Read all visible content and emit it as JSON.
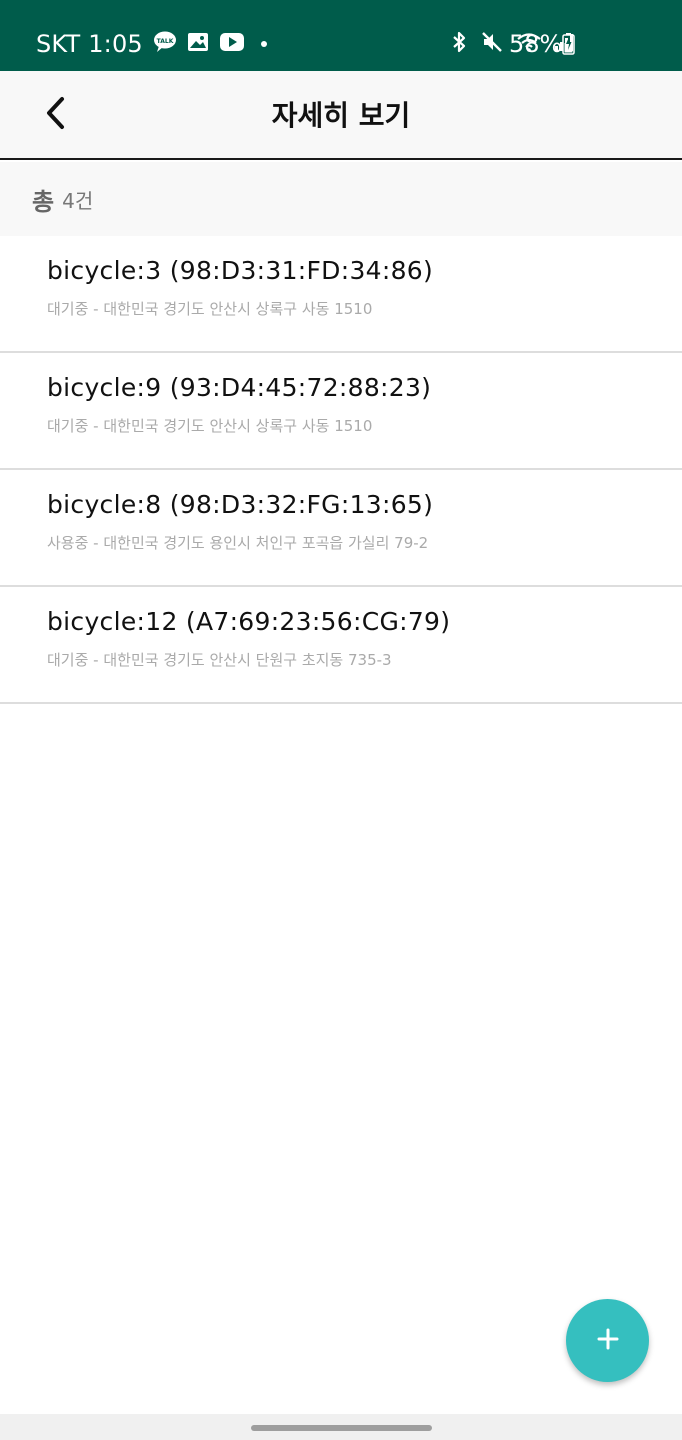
{
  "status_bar": {
    "carrier_time": "SKT 1:05",
    "battery": "58%",
    "icons": [
      "kakaotalk-icon",
      "gallery-icon",
      "youtube-icon",
      "bluetooth-icon",
      "mute-icon",
      "wifi-icon",
      "signal-icon",
      "battery-charging-icon"
    ],
    "background_color": "#005c4b"
  },
  "app_bar": {
    "title": "자세히 보기",
    "back_icon": "chevron-left-icon"
  },
  "summary": {
    "prefix": "총",
    "count": "4건"
  },
  "devices": [
    {
      "title": "bicycle:3 (98:D3:31:FD:34:86)",
      "subtitle": "대기중 - 대한민국 경기도 안산시 상록구 사동 1510"
    },
    {
      "title": "bicycle:9 (93:D4:45:72:88:23)",
      "subtitle": "대기중 - 대한민국 경기도 안산시 상록구 사동 1510"
    },
    {
      "title": "bicycle:8 (98:D3:32:FG:13:65)",
      "subtitle": "사용중 - 대한민국 경기도 용인시 처인구 포곡읍 가실리 79-2"
    },
    {
      "title": "bicycle:12 (A7:69:23:56:CG:79)",
      "subtitle": "대기중 - 대한민국 경기도 안산시 단원구 초지동 735-3"
    }
  ],
  "fab": {
    "icon": "plus-icon",
    "color": "#35bfbf"
  }
}
